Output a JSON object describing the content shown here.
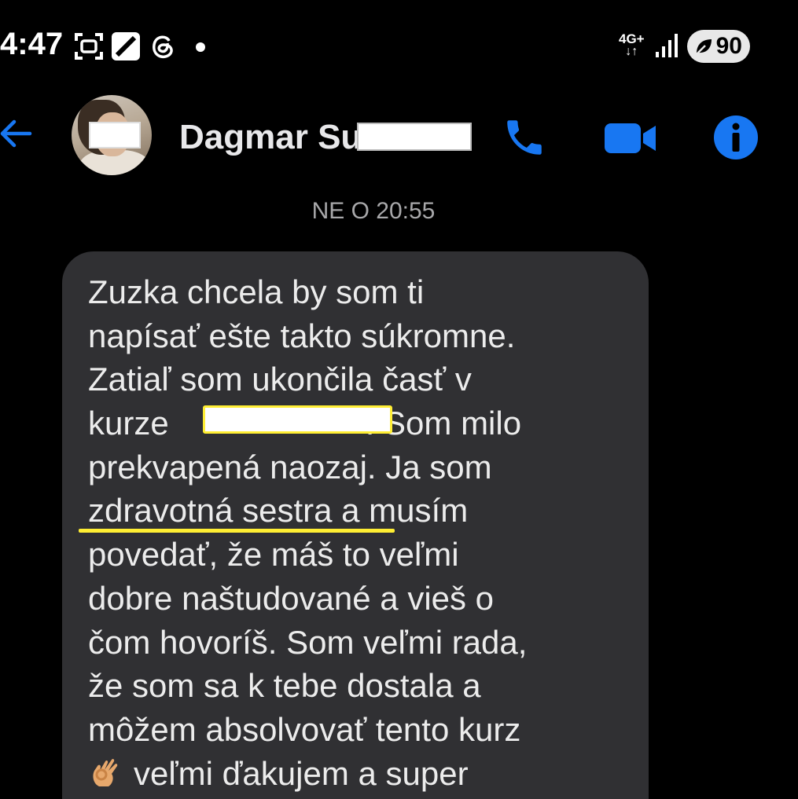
{
  "status_bar": {
    "time": "4:47",
    "network_type": "4G+",
    "network_arrows": "↓↑",
    "battery_level": "90",
    "icons": [
      "screen-record-icon",
      "flipboard-icon",
      "threads-icon",
      "notification-dot-icon",
      "signal-icon",
      "battery-saver-leaf-icon"
    ]
  },
  "header": {
    "contact_name": "Dagmar Su",
    "icons": [
      "back-arrow-icon",
      "phone-icon",
      "video-camera-icon",
      "info-icon"
    ],
    "accent_color": "#1877f2"
  },
  "conversation": {
    "timestamp": "NE O 20:55",
    "message_lines": [
      "Zuzka chcela by som ti",
      "napísať ešte takto súkromne.",
      "Zatiaľ som ukončila časť v",
      "kurze",
      ". Som milo",
      "prekvapená naozaj. Ja som",
      "zdravotná sestra a musím",
      "povedať, že máš to veľmi",
      "dobre naštudované a vieš o",
      "čom hovoríš. Som veľmi rada,",
      "že som sa k tebe dostala a",
      "môžem absolvovať tento kurz",
      "veľmi ďakujem a super"
    ],
    "emoji": "ok-hand-emoji",
    "highlight_color": "#ffee33",
    "bubble_color": "#303033"
  }
}
